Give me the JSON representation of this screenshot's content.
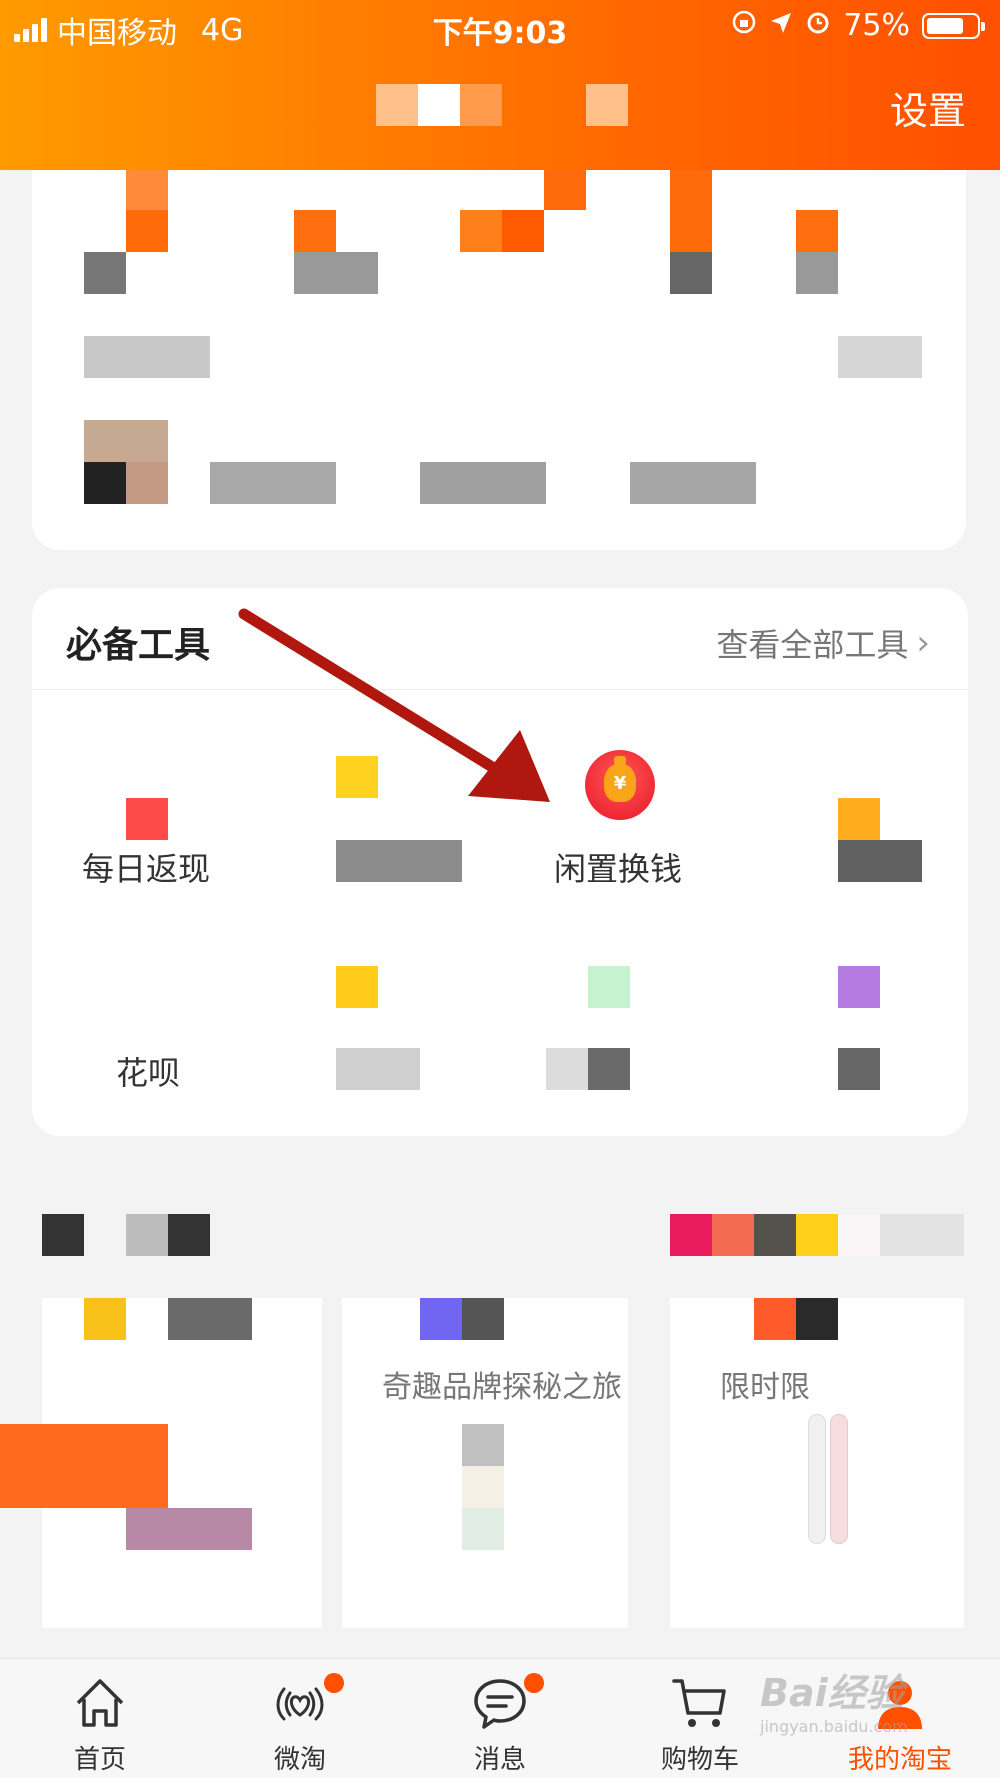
{
  "status_bar": {
    "carrier": "中国移动",
    "network": "4G",
    "time": "下午9:03",
    "battery_percent": "75%",
    "battery_level": 0.75
  },
  "header": {
    "settings_label": "设置",
    "accent_color": "#ff6a00"
  },
  "tools": {
    "title": "必备工具",
    "view_all": "查看全部工具",
    "items": [
      {
        "label": "每日返现"
      },
      {
        "label": "闲置换钱",
        "icon": "money-bag-icon"
      },
      {
        "label": "花呗"
      }
    ]
  },
  "promos": [
    {
      "title": "奇趣品牌探秘之旅"
    },
    {
      "title": "限时限"
    }
  ],
  "tabbar": {
    "items": [
      {
        "label": "首页",
        "icon": "home-icon"
      },
      {
        "label": "微淘",
        "icon": "heart-broadcast-icon",
        "badge": true
      },
      {
        "label": "消息",
        "icon": "message-icon",
        "badge": true
      },
      {
        "label": "购物车",
        "icon": "cart-icon"
      },
      {
        "label": "我的淘宝",
        "icon": "profile-icon",
        "active": true
      }
    ],
    "active_color": "#ff5000"
  },
  "watermark": {
    "brand": "Bai经验",
    "url": "jingyan.baidu.com"
  }
}
